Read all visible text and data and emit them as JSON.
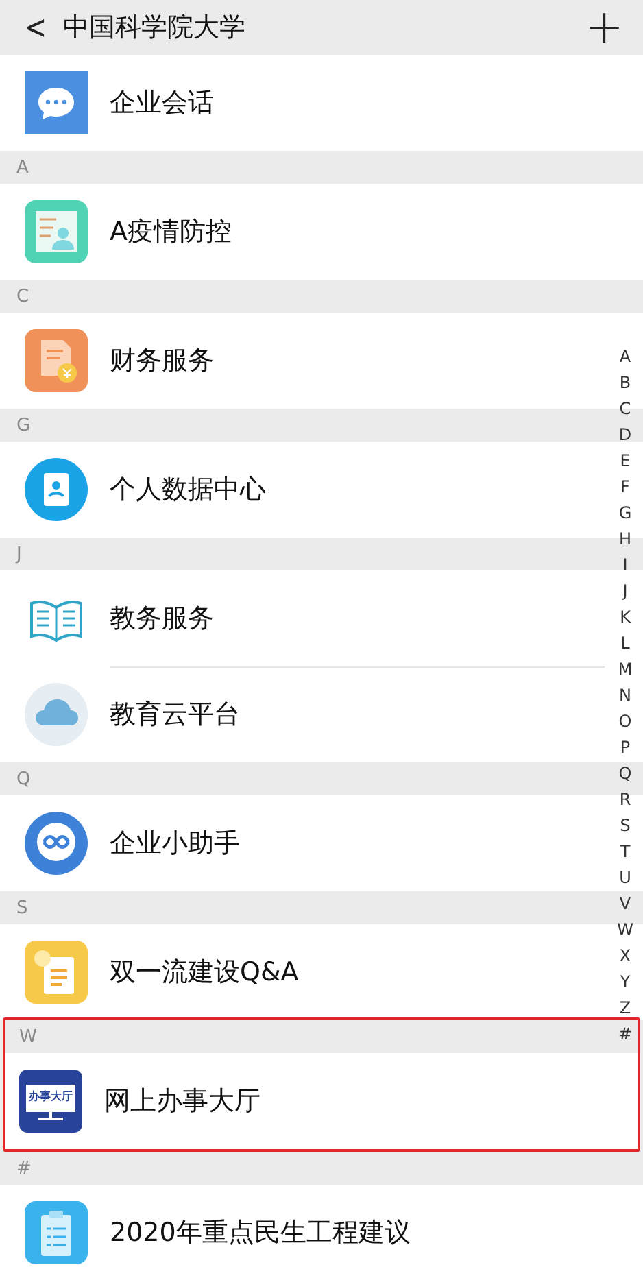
{
  "header": {
    "back": "<",
    "title": "中国科学院大学",
    "add": "+"
  },
  "sections": [
    {
      "highlighted": false,
      "items": [
        {
          "kind": "chat",
          "label": "企业会话"
        }
      ]
    },
    {
      "letter": "A",
      "highlighted": false,
      "items": [
        {
          "kind": "epidemic",
          "label": "A疫情防控"
        }
      ]
    },
    {
      "letter": "C",
      "highlighted": false,
      "items": [
        {
          "kind": "finance",
          "label": "财务服务"
        }
      ]
    },
    {
      "letter": "G",
      "highlighted": false,
      "items": [
        {
          "kind": "data",
          "label": "个人数据中心"
        }
      ]
    },
    {
      "letter": "J",
      "highlighted": false,
      "items": [
        {
          "kind": "book",
          "label": "教务服务"
        },
        {
          "kind": "cloud",
          "label": "教育云平台"
        }
      ]
    },
    {
      "letter": "Q",
      "highlighted": false,
      "items": [
        {
          "kind": "assistant",
          "label": "企业小助手"
        }
      ]
    },
    {
      "letter": "S",
      "highlighted": false,
      "items": [
        {
          "kind": "doc",
          "label": "双一流建设Q&A"
        }
      ]
    },
    {
      "letter": "W",
      "highlighted": true,
      "items": [
        {
          "kind": "hall",
          "icon_text": "办事大厅",
          "label": "网上办事大厅"
        }
      ]
    },
    {
      "letter": "#",
      "highlighted": false,
      "items": [
        {
          "kind": "clipboard",
          "label": "2020年重点民生工程建议"
        }
      ]
    }
  ],
  "index_bar": [
    "A",
    "B",
    "C",
    "D",
    "E",
    "F",
    "G",
    "H",
    "I",
    "J",
    "K",
    "L",
    "M",
    "N",
    "O",
    "P",
    "Q",
    "R",
    "S",
    "T",
    "U",
    "V",
    "W",
    "X",
    "Y",
    "Z",
    "#"
  ]
}
